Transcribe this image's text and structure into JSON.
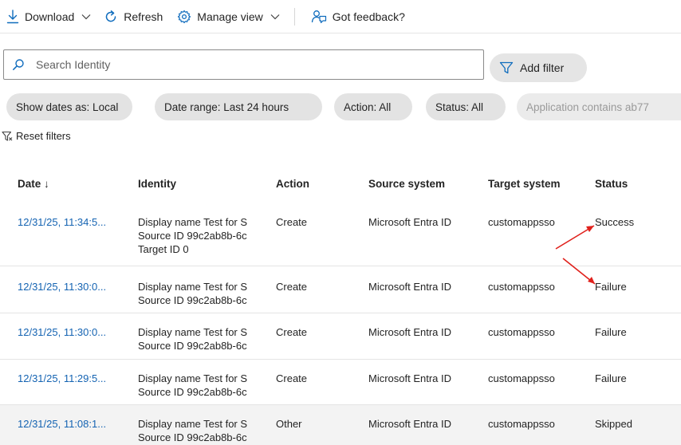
{
  "toolbar": {
    "download_label": "Download",
    "refresh_label": "Refresh",
    "manage_view_label": "Manage view",
    "feedback_label": "Got feedback?"
  },
  "search": {
    "placeholder": "Search Identity",
    "value": ""
  },
  "add_filter_label": "Add filter",
  "filters": [
    "Show dates as: Local",
    "Date range: Last 24 hours",
    "Action: All",
    "Status: All",
    "Application contains ab77"
  ],
  "reset_filters_label": "Reset filters",
  "table": {
    "headers": {
      "date": "Date ↓",
      "identity": "Identity",
      "action": "Action",
      "source": "Source system",
      "target": "Target system",
      "status": "Status"
    },
    "rows": [
      {
        "date": "12/31/25, 11:34:5...",
        "identity": [
          "Display name Test for S",
          "Source ID 99c2ab8b-6c",
          "Target ID 0"
        ],
        "action": "Create",
        "source": "Microsoft Entra ID",
        "target": "customappsso",
        "status": "Success"
      },
      {
        "date": "12/31/25, 11:30:0...",
        "identity": [
          "Display name Test for S",
          "Source ID 99c2ab8b-6c"
        ],
        "action": "Create",
        "source": "Microsoft Entra ID",
        "target": "customappsso",
        "status": "Failure"
      },
      {
        "date": "12/31/25, 11:30:0...",
        "identity": [
          "Display name Test for S",
          "Source ID 99c2ab8b-6c"
        ],
        "action": "Create",
        "source": "Microsoft Entra ID",
        "target": "customappsso",
        "status": "Failure"
      },
      {
        "date": "12/31/25, 11:29:5...",
        "identity": [
          "Display name Test for S",
          "Source ID 99c2ab8b-6c"
        ],
        "action": "Create",
        "source": "Microsoft Entra ID",
        "target": "customappsso",
        "status": "Failure"
      },
      {
        "date": "12/31/25, 11:08:1...",
        "identity": [
          "Display name Test for S",
          "Source ID 99c2ab8b-6c"
        ],
        "action": "Other",
        "source": "Microsoft Entra ID",
        "target": "customappsso",
        "status": "Skipped"
      }
    ]
  },
  "icons": {
    "download": "download-arrow-icon",
    "refresh": "refresh-icon",
    "manage_view": "gear-icon",
    "feedback": "feedback-person-icon",
    "search": "search-icon",
    "filter": "funnel-icon",
    "reset": "funnel-reset-icon",
    "chevron": "chevron-down-icon"
  },
  "colors": {
    "link": "#1463b2",
    "accent": "#0f6cbd",
    "annotation_arrow": "#e0201b",
    "pill_background": "#e3e3e3"
  }
}
